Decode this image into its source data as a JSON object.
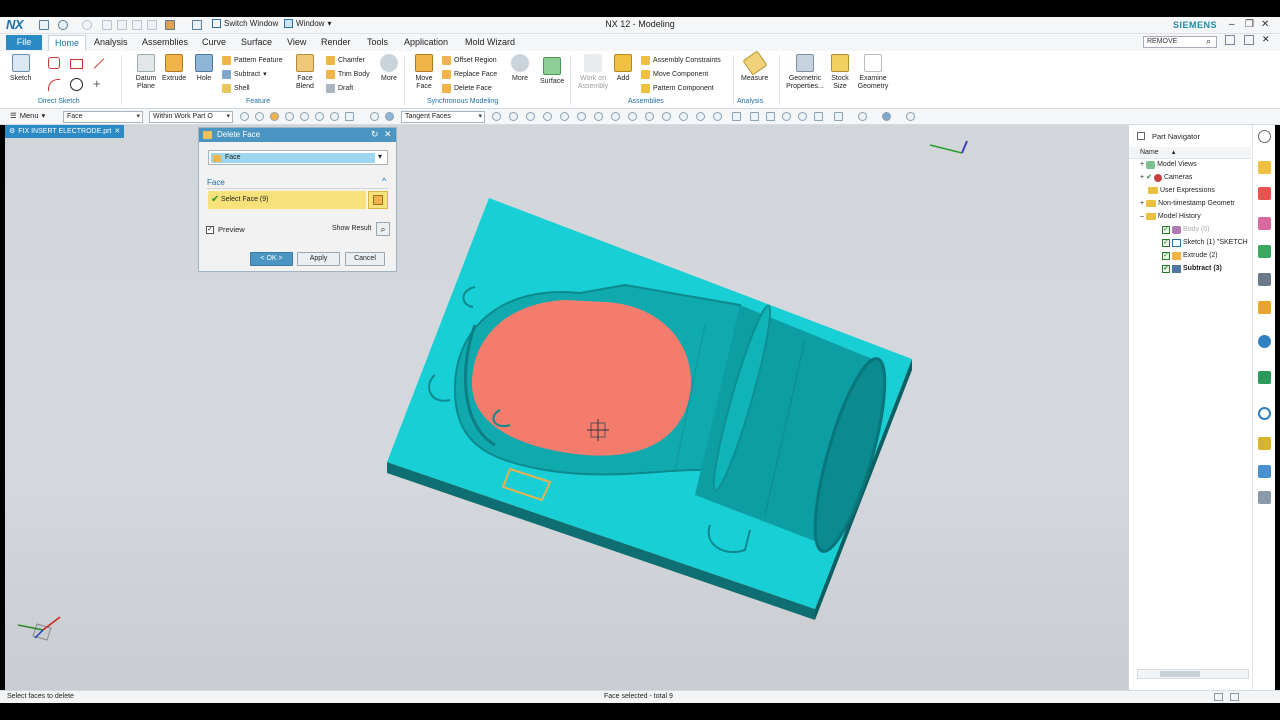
{
  "titlebar": {
    "logo": "NX",
    "app_title": "NX 12 - Modeling",
    "switch_window": "Switch Window",
    "window_menu": "Window",
    "brand": "SIEMENS",
    "minimize": "–",
    "restore": "❐",
    "close": "✕"
  },
  "menu": {
    "file": "File",
    "tabs": [
      "Home",
      "Analysis",
      "Assemblies",
      "Curve",
      "Surface",
      "View",
      "Render",
      "Tools",
      "Application",
      "Mold Wizard"
    ],
    "search_value": "REMOVE"
  },
  "ribbon": {
    "direct_sketch": {
      "sketch": "Sketch",
      "group": "Direct Sketch"
    },
    "feature": {
      "datum_plane": "Datum Plane",
      "extrude": "Extrude",
      "hole": "Hole",
      "pattern_feature": "Pattern Feature",
      "subtract": "Subtract",
      "shell": "Shell",
      "face_blend": "Face Blend",
      "chamfer": "Chamfer",
      "trim_body": "Trim Body",
      "draft": "Draft",
      "more": "More",
      "group": "Feature"
    },
    "sync": {
      "move_face": "Move Face",
      "offset_region": "Offset Region",
      "replace_face": "Replace Face",
      "delete_face": "Delete Face",
      "more": "More",
      "group": "Synchronous Modeling"
    },
    "surface": {
      "label": "Surface"
    },
    "assemblies": {
      "work_on_assembly": "Work on Assembly",
      "add": "Add",
      "assembly_constraints": "Assembly Constraints",
      "move_component": "Move Component",
      "pattern_component": "Pattern Component",
      "group": "Assemblies"
    },
    "analysis": {
      "measure": "Measure",
      "group": "Analysis"
    },
    "extra": {
      "geometric_properties": "Geometric Properties...",
      "stock_size": "Stock Size",
      "examine_geometry": "Examine Geometry"
    }
  },
  "toolbar2": {
    "menu_label": "Menu",
    "filter": "Face",
    "scope": "Within Work Part O",
    "rule": "Tangent Faces"
  },
  "viewport": {
    "file_tab": "FIX INSERT ELECTRODE.prt"
  },
  "dialog": {
    "title": "Delete Face",
    "type_value": "Face",
    "section": "Face",
    "select_label": "Select Face (9)",
    "preview": "Preview",
    "show_result": "Show Result",
    "ok": "< OK >",
    "apply": "Apply",
    "cancel": "Cancel"
  },
  "navigator": {
    "title": "Part Navigator",
    "column": "Name",
    "items": [
      {
        "label": "Model Views"
      },
      {
        "label": "Cameras"
      },
      {
        "label": "User Expressions"
      },
      {
        "label": "Non-timestamp Geometr"
      },
      {
        "label": "Model History"
      },
      {
        "label": "Body (0)"
      },
      {
        "label": "Sketch (1) \"SKETCH"
      },
      {
        "label": "Extrude (2)"
      },
      {
        "label": "Subtract (3)"
      }
    ]
  },
  "status": {
    "left": "Select faces to delete",
    "center": "Face selected - total 9"
  },
  "colors": {
    "accent": "#2b8ac4",
    "model_cyan": "#17cfd4",
    "selected_face": "#f47c6c",
    "dialog_highlight": "#f6e17a"
  }
}
